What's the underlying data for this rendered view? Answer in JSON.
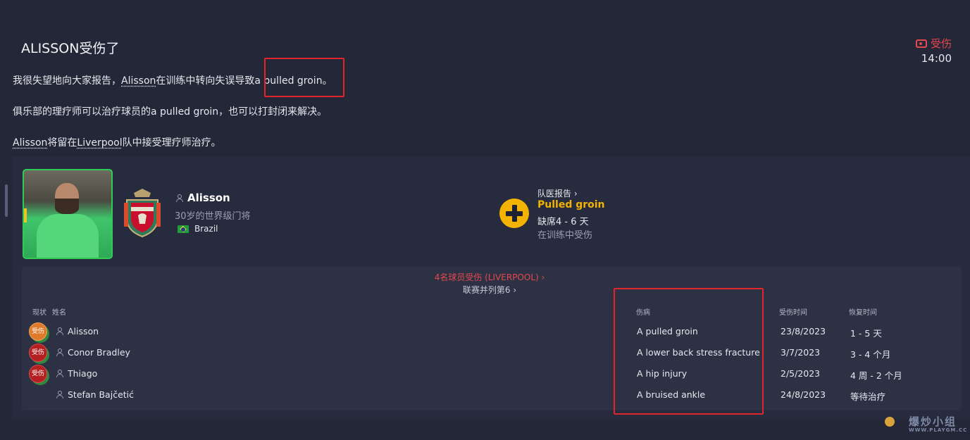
{
  "message": {
    "title": "ALISSON受伤了",
    "category": "受伤",
    "time": "14:00",
    "p1_pre": "我很失望地向大家报告，",
    "p1_player": "Alisson",
    "p1_mid": "在训练中转向失误导致",
    "p1_injury": "a pulled groin",
    "p1_end": "。",
    "p2": "俱乐部的理疗师可以治疗球员的a pulled groin，也可以打封闭来解决。",
    "p3_player": "Alisson",
    "p3_mid": "将留在",
    "p3_club": "Liverpool",
    "p3_end": "队中接受理疗师治疗。"
  },
  "player": {
    "name": "Alisson",
    "description": "30岁的世界级门将",
    "nationality": "Brazil"
  },
  "medical": {
    "report_link": "队医报告 ›",
    "injury": "Pulled groin",
    "absence": "缺席4 - 6 天",
    "cause": "在训练中受伤"
  },
  "squad": {
    "injured_count": "4名球员受伤 (LIVERPOOL) ›",
    "league_rank": "联赛并列第6 ›",
    "headers": {
      "status": "现状",
      "name": "姓名",
      "injury": "伤病",
      "date": "受伤时间",
      "recovery": "恢复时间"
    },
    "rows": [
      {
        "status": "受伤",
        "name": "Alisson",
        "injury": "A pulled groin",
        "date": "23/8/2023",
        "recovery": "1 - 5 天"
      },
      {
        "status": "受伤",
        "name": "Conor Bradley",
        "injury": "A lower back stress fracture",
        "date": "3/7/2023",
        "recovery": "3 - 4 个月"
      },
      {
        "status": "受伤",
        "name": "Thiago",
        "injury": "A hip injury",
        "date": "2/5/2023",
        "recovery": "4 周 - 2 个月"
      },
      {
        "status": "",
        "name": "Stefan Bajčetić",
        "injury": "A bruised ankle",
        "date": "24/8/2023",
        "recovery": "等待治疗"
      }
    ]
  },
  "watermark": {
    "text": "爆炒小组",
    "url": "WWW.PLAYGM.CC"
  },
  "colors": {
    "background": "#232738",
    "accent_injury": "#e5484d",
    "medical_yellow": "#f3b300",
    "highlight_box": "#e0262b",
    "photo_border": "#2ecc55"
  }
}
